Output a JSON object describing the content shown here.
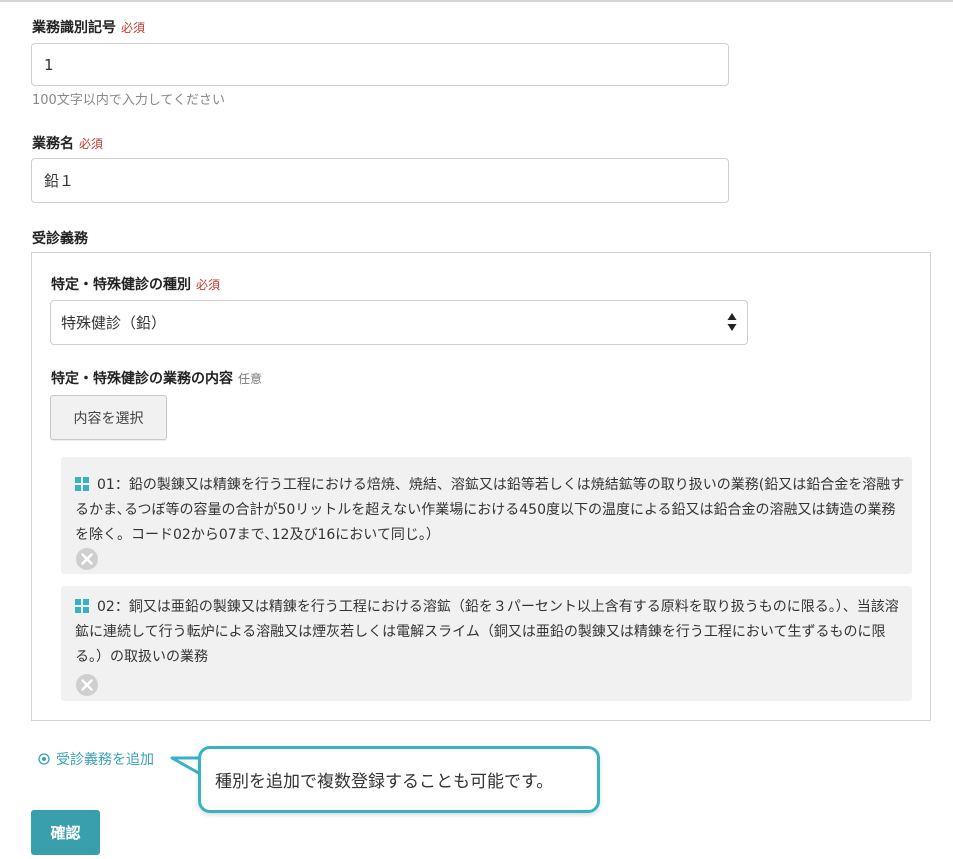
{
  "form": {
    "business_id": {
      "label": "業務識別記号",
      "required": "必須",
      "value": "1",
      "hint": "100文字以内で入力してください"
    },
    "business_name": {
      "label": "業務名",
      "required": "必須",
      "value": "鉛１"
    },
    "duties": {
      "label": "受診義務",
      "exam_type": {
        "label": "特定・特殊健診の種別",
        "required": "必須",
        "selected": "特殊健診（鉛）"
      },
      "exam_content": {
        "label": "特定・特殊健診の業務の内容",
        "optional": "任意",
        "choose_button": "内容を選択"
      },
      "items": [
        {
          "text": "01：鉛の製錬又は精錬を行う工程における焙焼、焼結、溶鉱又は鉛等若しくは焼結鉱等の取り扱いの業務(鉛又は鉛合金を溶融するかま､るつぼ等の容量の合計が50リットルを超えない作業場における450度以下の温度による鉛又は鉛合金の溶融又は鋳造の業務を除く。コード02から07まで､12及び16において同じ。）",
          "icon": "grid-icon",
          "remove_icon": "remove-icon"
        },
        {
          "text": "02：銅又は亜鉛の製錬又は精錬を行う工程における溶鉱（鉛を３パーセント以上含有する原料を取り扱うものに限る。）、当該溶鉱に連続して行う転炉による溶融又は煙灰若しくは電解スライム（銅又は亜鉛の製錬又は精錬を行う工程において生ずるものに限る。）の取扱いの業務",
          "icon": "grid-icon",
          "remove_icon": "remove-icon"
        }
      ]
    },
    "add_duty_link": "受診義務を追加",
    "callout": "種別を追加で複数登録することも可能です。",
    "confirm_button": "確認"
  },
  "colors": {
    "accent": "#3ab2c6",
    "button": "#3a9fad",
    "required": "#c0392b",
    "grid_icon": "#3ab2c6"
  }
}
